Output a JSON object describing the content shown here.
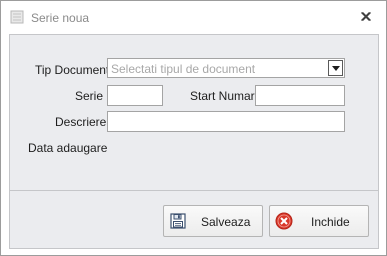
{
  "window": {
    "title": "Serie noua",
    "app_icon": "document-list-icon",
    "close_icon": "close-icon"
  },
  "form": {
    "tip_document_label": "Tip Document",
    "tip_document_placeholder": "Selectati tipul de document",
    "serie_label": "Serie",
    "serie_value": "",
    "start_numar_label": "Start Numar",
    "start_numar_value": "",
    "descriere_label": "Descriere",
    "descriere_value": "",
    "data_adaugare_label": "Data adaugare"
  },
  "buttons": {
    "save_label": "Salveaza",
    "save_icon": "save-icon",
    "close_label": "Inchide",
    "close_icon": "cancel-icon",
    "close_icon_color": "#d9372a"
  }
}
